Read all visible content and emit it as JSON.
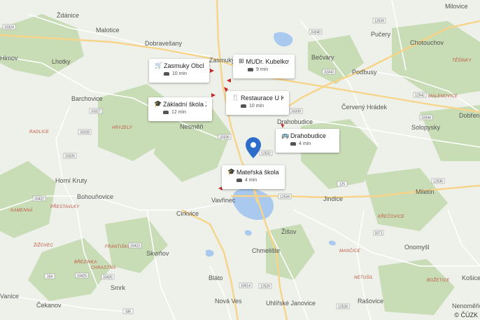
{
  "map": {
    "towns": [
      "Ždánice",
      "Malotice",
      "Dobravešany",
      "Zasmuky",
      "Lhotky",
      "Barchovice",
      "Nesměň",
      "Horní Kruty",
      "Bohouňovice",
      "Cirkvice",
      "Vavřinec",
      "Skvrňov",
      "Smrk",
      "Čekanov",
      "Vanice",
      "Bláto",
      "Nová Ves",
      "Uhlířské Janovice",
      "Chmelište",
      "Žišov",
      "Drahobudice",
      "Pučery",
      "Chotouchov",
      "Bečváry",
      "Poďbusy",
      "Červený Hrádek",
      "Dobřen",
      "Solopysky",
      "Miletín",
      "Jindice",
      "Onomyšl",
      "Rašovice",
      "Košice",
      "Nenoměřice",
      "Milovice",
      "Hlmov"
    ],
    "regions": [
      "RADLICE",
      "HRYZELY",
      "KAMENNÁ",
      "PŘESTAVLKY",
      "ŽIŽOVEC",
      "FRANTIŠKOV",
      "BŘEZINKA",
      "CHRASTNÁ",
      "MALENOVICE",
      "TĚŠÍNKY",
      "KŘEČOVICE",
      "MANČICE",
      "NETUŠIL",
      "BOŽETICE"
    ],
    "roads": [
      "33324",
      "33340",
      "12539",
      "33343",
      "12542",
      "33327",
      "33328",
      "33326",
      "33422",
      "33423",
      "33425",
      "33426",
      "33336",
      "33339",
      "12532",
      "12534",
      "125",
      "12536",
      "33344",
      "3371",
      "33514",
      "12529",
      "12528",
      "335",
      "334"
    ]
  },
  "pois": [
    {
      "icon": "cart-icon",
      "title": "Zasmuky Obchod...",
      "time": "10 min"
    },
    {
      "icon": "hospital-icon",
      "title": "MUDr. Kubelková ...",
      "time": "9 min"
    },
    {
      "icon": "school-icon",
      "title": "Základní škola Zá...",
      "time": "12 min"
    },
    {
      "icon": "restaurant-icon",
      "title": "Restaurace U Kozy",
      "time": "10 min"
    },
    {
      "icon": "bus-icon",
      "title": "Drahobudice",
      "time": "4 min"
    },
    {
      "icon": "school-icon",
      "title": "Mateřská škola V...",
      "time": "4 min"
    }
  ],
  "attribution": "© ČÚZK",
  "colors": {
    "water": "#a9c9ef",
    "forest": "#c8ddb6",
    "land": "#eef0ea",
    "road_major": "#f7d489",
    "road_minor": "#ffffff",
    "marker": "#2e6ecb"
  }
}
